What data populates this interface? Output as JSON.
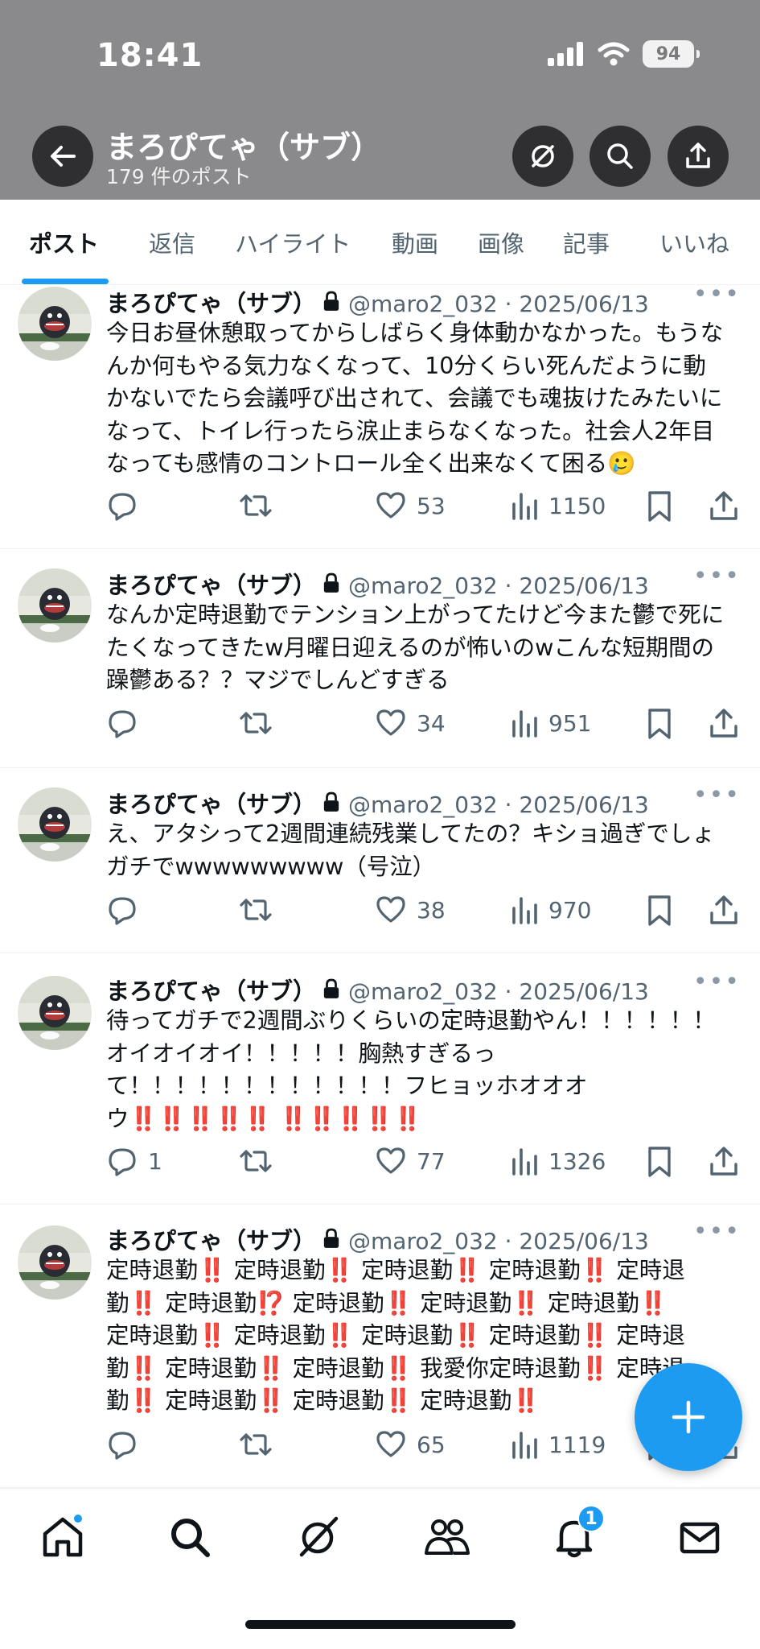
{
  "status_bar": {
    "time": "18:41",
    "battery": "94"
  },
  "header": {
    "title": "まろぴてゃ（サブ）",
    "subtitle": "179 件のポスト"
  },
  "tabs": [
    "ポスト",
    "返信",
    "ハイライト",
    "動画",
    "画像",
    "記事",
    "いいね"
  ],
  "posts": [
    {
      "author": "まろぴてゃ（サブ）",
      "meta": "@maro2_032 · 2025/06/13",
      "lines": [
        "今日お昼休憩取ってからしばらく身体動かなかった。もうな",
        "んか何もやる気力なくなって、10分くらい死んだように動",
        "かないでたら会議呼び出されて、会議でも魂抜けたみたいに",
        "なって、トイレ行ったら涙止まらなくなった。社会人2年目",
        "なっても感情のコントロール全く出来なくて困る🥲"
      ],
      "replies": "",
      "likes": "53",
      "views": "1150"
    },
    {
      "author": "まろぴてゃ（サブ）",
      "meta": "@maro2_032 · 2025/06/13",
      "lines": [
        "なんか定時退勤でテンション上がってたけど今また鬱で死に",
        "たくなってきたw月曜日迎えるのが怖いのwこんな短期間の",
        "躁鬱ある？？マジでしんどすぎる"
      ],
      "replies": "",
      "likes": "34",
      "views": "951"
    },
    {
      "author": "まろぴてゃ（サブ）",
      "meta": "@maro2_032 · 2025/06/13",
      "lines": [
        "え、アタシって2週間連続残業してたの？キショ過ぎでしょ",
        "ガチでwwwwwwwww（号泣）"
      ],
      "replies": "",
      "likes": "38",
      "views": "970"
    },
    {
      "author": "まろぴてゃ（サブ）",
      "meta": "@maro2_032 · 2025/06/13",
      "lines": [
        "待ってガチで2週間ぶりくらいの定時退勤やん！！！！！！",
        "オイオイオイ！！！！！胸熱すぎるっ",
        "て！！！！！！！！！！！！フヒョッホオオオ",
        "ウ‼️‼️‼️‼️‼️ ‼️‼️‼️‼️‼️"
      ],
      "replies": "1",
      "likes": "77",
      "views": "1326"
    },
    {
      "author": "まろぴてゃ（サブ）",
      "meta": "@maro2_032 · 2025/06/13",
      "lines": [
        "定時退勤‼️ 定時退勤‼️ 定時退勤‼️ 定時退勤‼️ 定時退",
        "勤‼️ 定時退勤⁉️ 定時退勤‼️ 定時退勤‼️ 定時退勤‼️",
        "定時退勤‼️ 定時退勤‼️ 定時退勤‼️ 定時退勤‼️ 定時退",
        "勤‼️ 定時退勤‼️ 定時退勤‼️ 我愛你定時退勤‼️ 定時退",
        "勤‼️ 定時退勤‼️ 定時退勤‼️ 定時退勤‼️"
      ],
      "replies": "",
      "likes": "65",
      "views": "1119"
    }
  ],
  "bottom_nav": [
    "home-icon",
    "search-icon",
    "grok-icon",
    "communities-icon",
    "notifications-icon",
    "messages-icon"
  ],
  "notification_count": "1",
  "colors": {
    "accent": "#1d9bf0",
    "header_bg": "#8a898b",
    "muted": "#536471"
  }
}
